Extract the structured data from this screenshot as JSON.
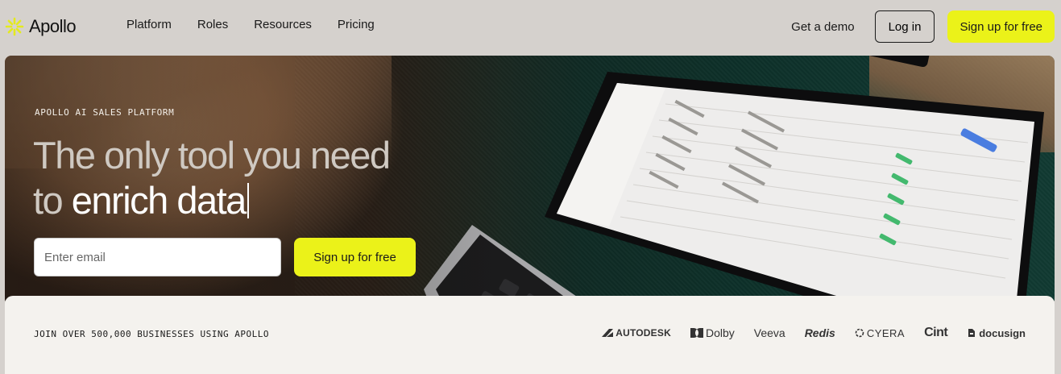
{
  "nav": {
    "logo_text": "Apollo",
    "links": [
      "Platform",
      "Roles",
      "Resources",
      "Pricing"
    ],
    "demo_label": "Get a demo",
    "login_label": "Log in",
    "signup_label": "Sign up for free"
  },
  "hero": {
    "eyebrow": "APOLLO AI SALES PLATFORM",
    "headline_line1": "The only tool you need",
    "headline_line2_light": "to ",
    "headline_line2_bold": "enrich data",
    "email_placeholder": "Enter email",
    "signup_label": "Sign up for free"
  },
  "strip": {
    "text": "JOIN OVER 500,000 BUSINESSES USING APOLLO",
    "brands": [
      "AUTODESK",
      "Dolby",
      "Veeva",
      "Redis",
      "CYERA",
      "Cint",
      "docusign"
    ]
  },
  "colors": {
    "accent": "#ebf219",
    "page_bg": "#d5d1cd",
    "strip_bg": "#f4f2ee"
  }
}
